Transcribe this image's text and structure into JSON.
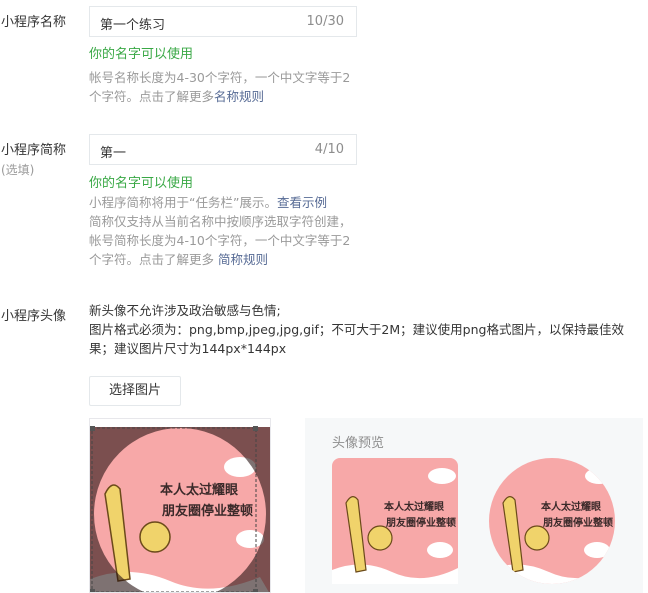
{
  "name_field": {
    "label": "小程序名称",
    "value": "第一个练习",
    "counter": "10/30",
    "ok_text": "你的名字可以使用",
    "tip_line1": "帐号名称长度为4-30个字符，一个中文字等于2",
    "tip_line2": "个字符。点击了解更多",
    "tip_link": "名称规则"
  },
  "short_name_field": {
    "label": "小程序简称",
    "sub_label": "(选填)",
    "value": "第一",
    "counter": "4/10",
    "ok_text": "你的名字可以使用",
    "tip_line1": "小程序简称将用于“任务栏”展示。",
    "tip_link1": "查看示例",
    "tip_line2": "简称仅支持从当前名称中按顺序选取字符创建，",
    "tip_line3": "帐号简称长度为4-10个字符，一个中文字等于2",
    "tip_line4": "个字符。点击了解更多 ",
    "tip_link2": "简称规则"
  },
  "avatar": {
    "label": "小程序头像",
    "desc_line1": "新头像不允许涉及政治敏感与色情;",
    "desc_line2": "图片格式必须为：png,bmp,jpeg,jpg,gif；不可大于2M；建议使用png格式图片，以保持最佳效",
    "desc_line3": "果；建议图片尺寸为144px*144px",
    "choose_button": "选择图片",
    "preview_title": "头像预览",
    "image_text_line1": "本人太过耀眼",
    "image_text_line2": "朋友圈停业整顿"
  },
  "colors": {
    "accent_green": "#39a845",
    "link_blue": "#576b95",
    "avatar_pink": "#f7a8a8"
  }
}
